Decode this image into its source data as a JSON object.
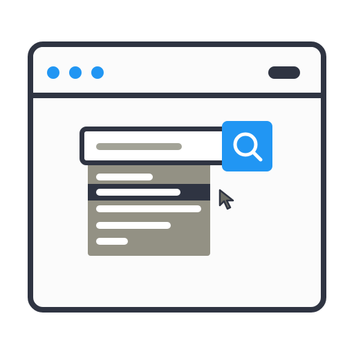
{
  "colors": {
    "frame": "#2f3442",
    "accent": "#2196f3",
    "dropdown": "#939184",
    "placeholder": "#a3a397",
    "option_text": "#ffffff",
    "cursor": "#6b6c64"
  },
  "window": {
    "controls": [
      "close-dot",
      "minimize-dot",
      "maximize-dot"
    ]
  },
  "search": {
    "icon": "magnifier-icon"
  },
  "dropdown": {
    "option_count": 5,
    "selected_index": 1
  },
  "cursor": {
    "icon": "arrow-cursor-icon"
  }
}
